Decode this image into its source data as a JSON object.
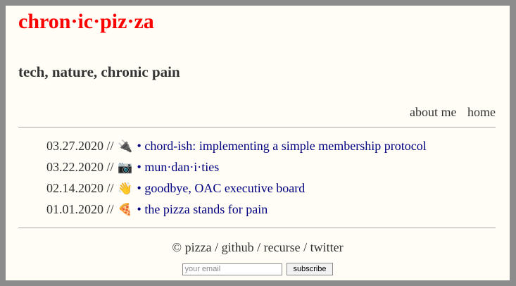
{
  "site": {
    "title": "chron·ic·piz·za",
    "tagline": "tech, nature, chronic pain"
  },
  "nav": [
    {
      "label": "about me"
    },
    {
      "label": "home"
    }
  ],
  "posts": [
    {
      "date": "03.27.2020 //",
      "emoji": "🔌",
      "bullet": "•",
      "title": "chord-ish: implementing a simple membership protocol"
    },
    {
      "date": "03.22.2020 //",
      "emoji": "📷",
      "bullet": "•",
      "title": "mun·dan·i·ties"
    },
    {
      "date": "02.14.2020 //",
      "emoji": "👋",
      "bullet": "•",
      "title": "goodbye, OAC executive board"
    },
    {
      "date": "01.01.2020 //",
      "emoji": "🍕",
      "bullet": "•",
      "title": "the pizza stands for pain"
    }
  ],
  "footer": {
    "copyright": "©",
    "links": [
      {
        "label": "pizza"
      },
      {
        "label": "github"
      },
      {
        "label": "recurse"
      },
      {
        "label": "twitter"
      }
    ],
    "separator": " / "
  },
  "subscribe": {
    "placeholder": "your email",
    "button_label": "subscribe"
  },
  "colors": {
    "title": "#ff0000",
    "link": "#000080",
    "text": "#333333",
    "background": "#fffdf5"
  }
}
